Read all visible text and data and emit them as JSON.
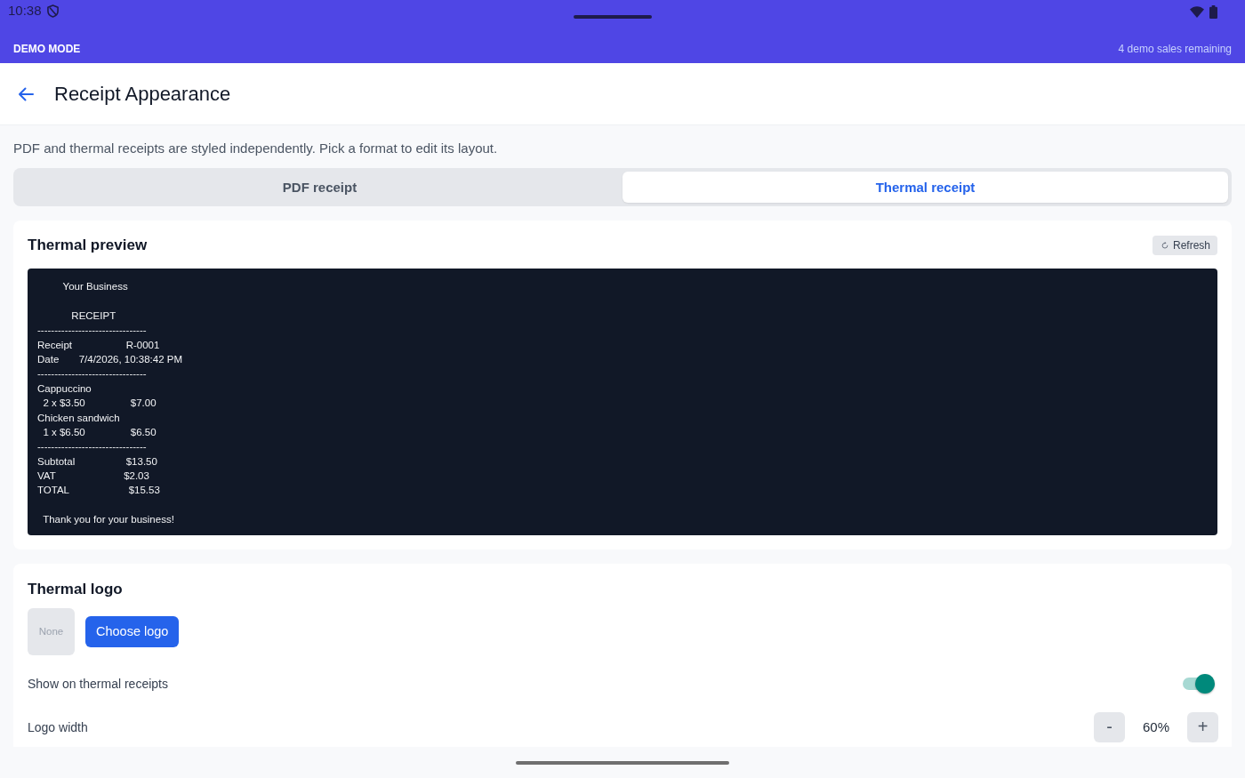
{
  "status_bar": {
    "time": "10:38"
  },
  "demo_banner": {
    "label": "DEMO MODE",
    "remaining": "4 demo sales remaining"
  },
  "app_bar": {
    "title": "Receipt Appearance"
  },
  "intro": "PDF and thermal receipts are styled independently. Pick a format to edit its layout.",
  "format_tabs": [
    {
      "label": "PDF receipt",
      "selected": false
    },
    {
      "label": "Thermal receipt",
      "selected": true
    }
  ],
  "preview_card": {
    "title": "Thermal preview",
    "refresh_button": "Refresh",
    "receipt_blocks": [
      [
        "         Your Business"
      ],
      [
        "            RECEIPT",
        "--------------------------------",
        "Receipt                   R-0001",
        "Date       7/4/2026, 10:38:42 PM",
        "--------------------------------",
        "Cappuccino",
        "  2 x $3.50                $7.00",
        "Chicken sandwich",
        "  1 x $6.50                $6.50",
        "--------------------------------",
        "Subtotal                  $13.50",
        "VAT                        $2.03",
        "TOTAL                     $15.53"
      ],
      [
        "  Thank you for your business!"
      ]
    ]
  },
  "logo_card": {
    "title": "Thermal logo",
    "logo_placeholder": "None",
    "choose_button": "Choose logo",
    "settings": [
      {
        "kind": "toggle",
        "label": "Show on thermal receipts",
        "on": true
      },
      {
        "kind": "stepper",
        "label": "Logo width",
        "value": "60%",
        "decrement": "-",
        "increment": "+"
      }
    ]
  }
}
